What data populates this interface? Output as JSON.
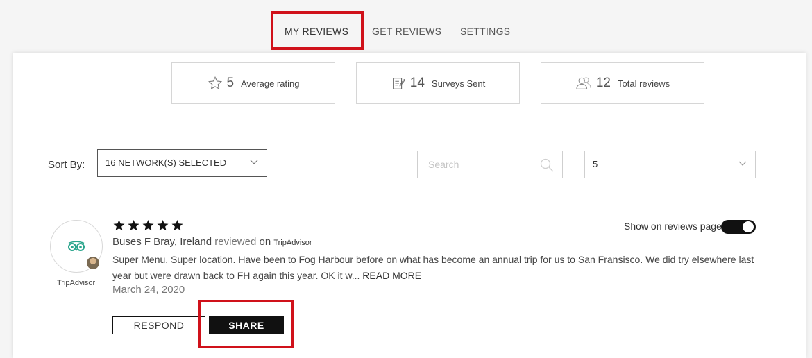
{
  "nav": {
    "tabs": [
      {
        "label": "MY REVIEWS"
      },
      {
        "label": "GET REVIEWS"
      },
      {
        "label": "SETTINGS"
      }
    ]
  },
  "stats": [
    {
      "value": "5",
      "label": "Average rating",
      "icon": "star-outline-icon"
    },
    {
      "value": "14",
      "label": "Surveys Sent",
      "icon": "survey-icon"
    },
    {
      "value": "12",
      "label": "Total reviews",
      "icon": "users-icon"
    }
  ],
  "filters": {
    "sort_label": "Sort By:",
    "network_value": "16 NETWORK(S) SELECTED",
    "search_placeholder": "Search",
    "search_value": "",
    "per_page_value": "5"
  },
  "review": {
    "source_caption": "TripAdvisor",
    "rating": 5,
    "reviewer": "Buses F Bray, Ireland",
    "reviewed_word": "reviewed",
    "on_word": "on",
    "network": "TripAdvisor",
    "text": "Super Menu, Super location. Have been to Fog Harbour before on what has become an annual trip for us to San Fransisco. We did try elsewhere last year but were drawn back to FH again this year. OK it w...",
    "read_more": "READ MORE",
    "date": "March 24, 2020",
    "show_on_page_label": "Show on reviews page",
    "show_on_page": true,
    "respond_label": "RESPOND",
    "share_label": "SHARE"
  },
  "colors": {
    "highlight": "#d0111a",
    "tripadvisor": "#2aa58c",
    "button_dark": "#111111"
  }
}
